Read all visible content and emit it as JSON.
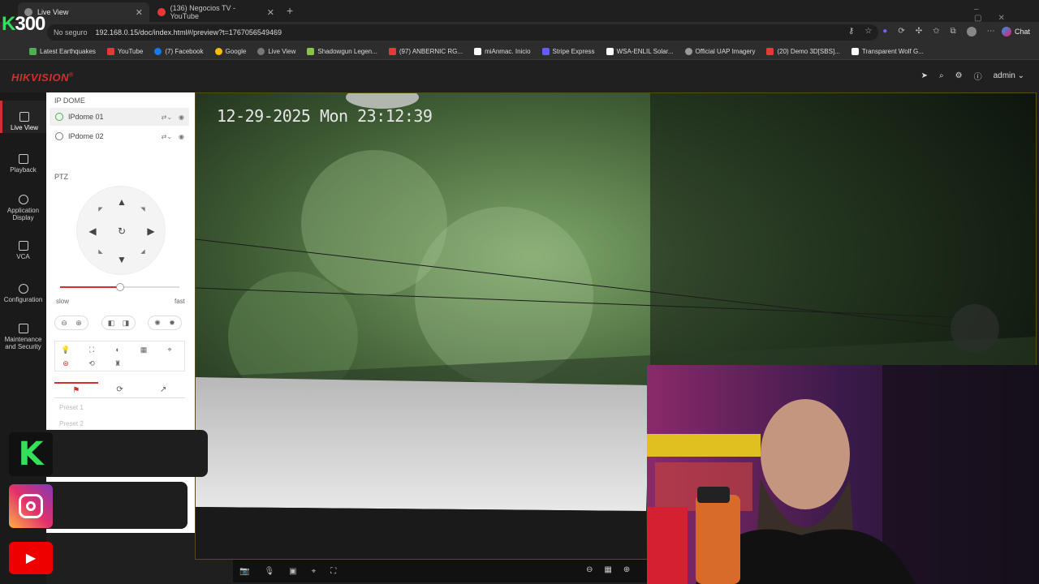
{
  "browser": {
    "tabs": [
      {
        "title": "Live View",
        "active": true
      },
      {
        "title": "(136) Negocios TV - YouTube",
        "active": false
      }
    ],
    "new_tab": "+",
    "address": {
      "security": "No seguro",
      "url": "192.168.0.15/doc/index.html#/preview?t=1767056549469"
    },
    "chat_label": "Chat",
    "bookmarks": [
      "Latest Earthquakes",
      "YouTube",
      "(7) Facebook",
      "Google",
      "Live View",
      "Shadowgun Legen...",
      "(97) ANBERNIC RG...",
      "miAnmac. Inicio",
      "Stripe Express",
      "WSA-ENLIL Solar...",
      "Official UAP Imagery",
      "(20) Demo 3D[SBS]...",
      "Transparent Wolf G..."
    ]
  },
  "app": {
    "logo": "HIKVISION",
    "logo_mark": "®",
    "user": "admin",
    "accent": "#d32f2f"
  },
  "nav": [
    {
      "label": "Live View",
      "icon": "live-view-icon",
      "active": true
    },
    {
      "label": "Playback",
      "icon": "playback-icon"
    },
    {
      "label": "Application Display",
      "icon": "application-icon"
    },
    {
      "label": "VCA",
      "icon": "vca-icon"
    },
    {
      "label": "Configuration",
      "icon": "gear-icon"
    },
    {
      "label": "Maintenance and Security",
      "icon": "maintenance-icon"
    }
  ],
  "panel": {
    "group": "IP DOME",
    "cameras": [
      "IPdome 01",
      "IPdome 02"
    ],
    "ptz_title": "PTZ",
    "speed_slow": "slow",
    "speed_fast": "fast",
    "speed_level": 0.5,
    "presets": [
      "Preset 1",
      "Preset 2"
    ]
  },
  "video": {
    "timestamp": "12-29-2025 Mon 23:12:39"
  },
  "stream_overlay": {
    "counter": "300",
    "counter_prefix": "K"
  }
}
